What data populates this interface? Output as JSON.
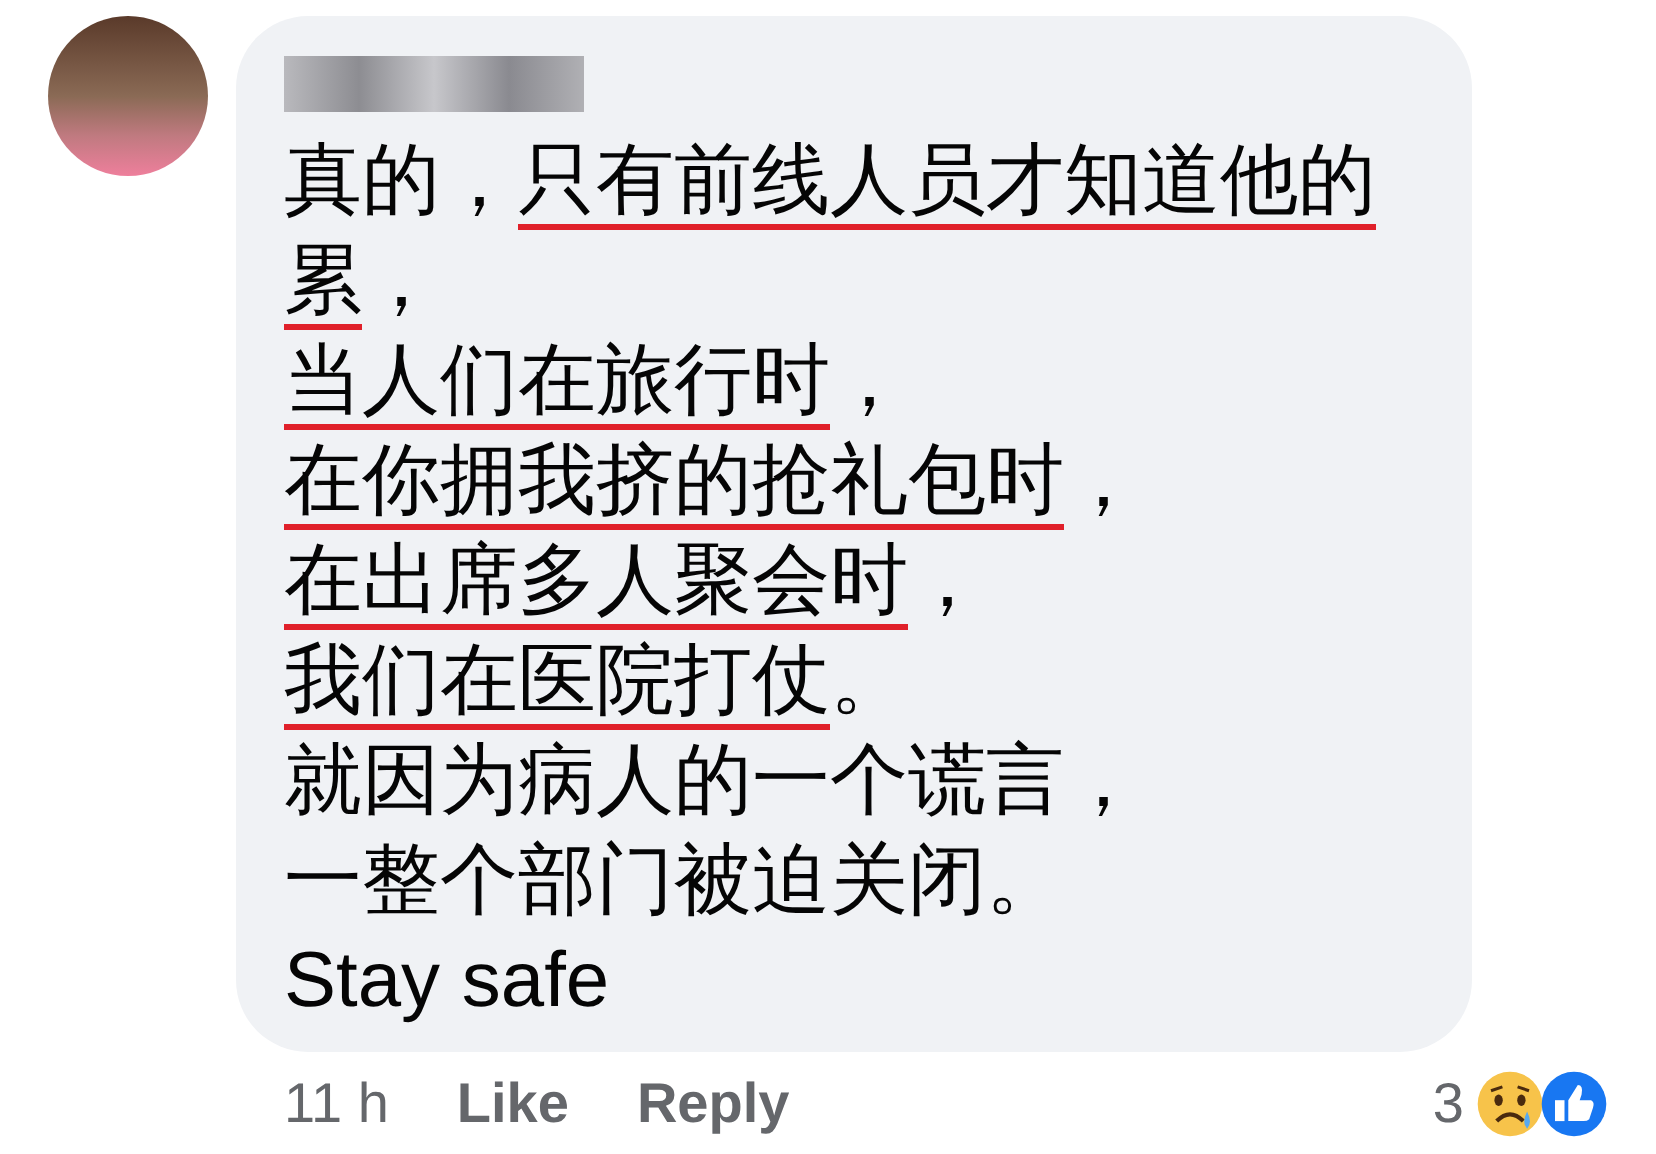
{
  "comment": {
    "lines": [
      {
        "segments": [
          {
            "text": "真的，",
            "underlined": false
          },
          {
            "text": "只有前线人员才知道他的",
            "underlined": true
          }
        ]
      },
      {
        "segments": [
          {
            "text": "累",
            "underlined": true
          },
          {
            "text": "，",
            "underlined": false
          }
        ]
      },
      {
        "segments": [
          {
            "text": "当人们在旅行时",
            "underlined": true
          },
          {
            "text": "，",
            "underlined": false
          }
        ]
      },
      {
        "segments": [
          {
            "text": "在你拥我挤的抢礼包时",
            "underlined": true
          },
          {
            "text": "，",
            "underlined": false
          }
        ]
      },
      {
        "segments": [
          {
            "text": "在出席多人聚会时",
            "underlined": true
          },
          {
            "text": "，",
            "underlined": false
          }
        ]
      },
      {
        "segments": [
          {
            "text": "我们在医院打仗",
            "underlined": true
          },
          {
            "text": "。",
            "underlined": false
          }
        ]
      },
      {
        "segments": [
          {
            "text": "就因为病人的一个谎言，",
            "underlined": false
          }
        ]
      },
      {
        "segments": [
          {
            "text": "一整个部门被迫关闭。",
            "underlined": false
          }
        ]
      },
      {
        "segments": [
          {
            "text": "Stay safe",
            "underlined": false
          }
        ]
      }
    ]
  },
  "actions": {
    "time": "11 h",
    "like": "Like",
    "reply": "Reply"
  },
  "reactions": {
    "count": "3"
  }
}
